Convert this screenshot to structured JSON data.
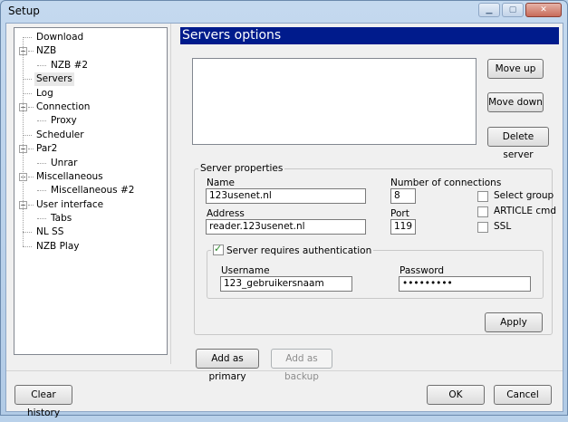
{
  "window": {
    "title": "Setup"
  },
  "tree": {
    "items": [
      {
        "label": "Download",
        "level": 0,
        "expander": ""
      },
      {
        "label": "NZB",
        "level": 0,
        "expander": "−"
      },
      {
        "label": "NZB #2",
        "level": 1,
        "expander": ""
      },
      {
        "label": "Servers",
        "level": 0,
        "expander": "",
        "selected": true
      },
      {
        "label": "Log",
        "level": 0,
        "expander": ""
      },
      {
        "label": "Connection",
        "level": 0,
        "expander": "−"
      },
      {
        "label": "Proxy",
        "level": 1,
        "expander": ""
      },
      {
        "label": "Scheduler",
        "level": 0,
        "expander": ""
      },
      {
        "label": "Par2",
        "level": 0,
        "expander": "−"
      },
      {
        "label": "Unrar",
        "level": 1,
        "expander": ""
      },
      {
        "label": "Miscellaneous",
        "level": 0,
        "expander": "−"
      },
      {
        "label": "Miscellaneous #2",
        "level": 1,
        "expander": ""
      },
      {
        "label": "User interface",
        "level": 0,
        "expander": "−"
      },
      {
        "label": "Tabs",
        "level": 1,
        "expander": ""
      },
      {
        "label": "NL SS",
        "level": 0,
        "expander": ""
      },
      {
        "label": "NZB Play",
        "level": 0,
        "expander": ""
      }
    ]
  },
  "panel": {
    "header": "Servers options",
    "buttons": {
      "move_up": "Move up",
      "move_down": "Move down",
      "delete_server": "Delete server",
      "apply": "Apply",
      "add_primary": "Add as primary",
      "add_backup": "Add as backup"
    },
    "server_properties": {
      "legend": "Server properties",
      "name_label": "Name",
      "name_value": "123usenet.nl",
      "address_label": "Address",
      "address_value": "reader.123usenet.nl",
      "connections_label": "Number of connections",
      "connections_value": "8",
      "port_label": "Port",
      "port_value": "119",
      "select_group_label": "Select group",
      "article_cmd_label": "ARTICLE cmd",
      "ssl_label": "SSL",
      "auth": {
        "legend": "Server requires authentication",
        "checked": true,
        "username_label": "Username",
        "username_value": "123_gebruikersnaam",
        "password_label": "Password",
        "password_value": "•••••••••"
      }
    }
  },
  "footer": {
    "clear_history": "Clear history",
    "ok": "OK",
    "cancel": "Cancel"
  }
}
